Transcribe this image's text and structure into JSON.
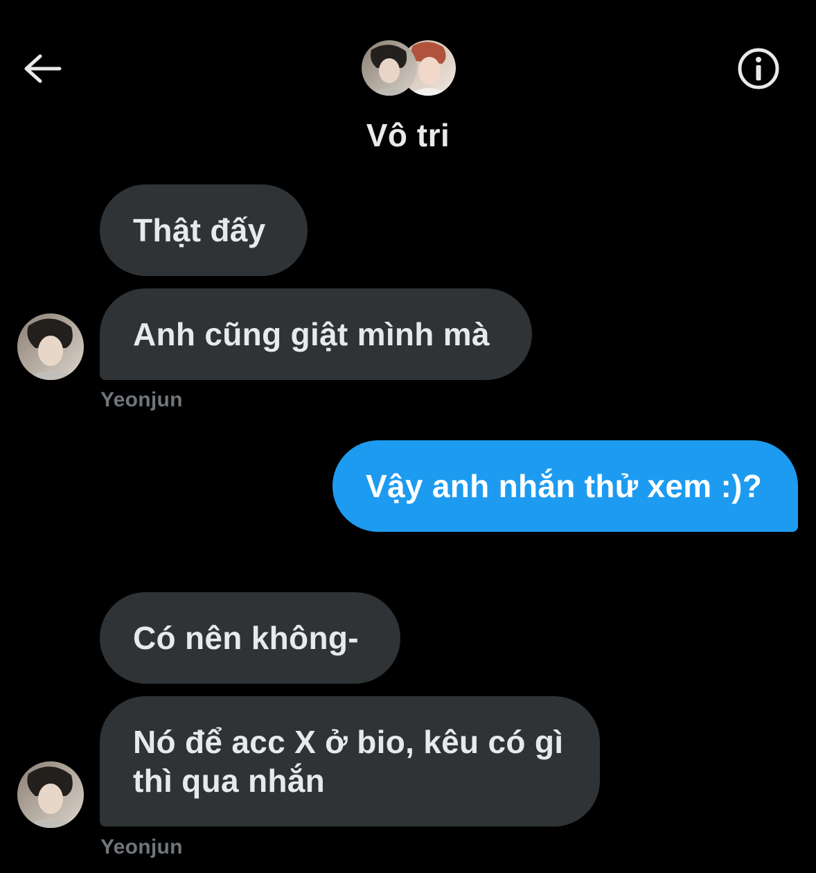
{
  "header": {
    "title": "Vô tri",
    "back_icon": "arrow-left-icon",
    "info_icon": "info-icon"
  },
  "colors": {
    "background": "#000000",
    "incoming_bubble": "#2f3336",
    "outgoing_bubble": "#1d9bf0",
    "text": "#e7e9ea",
    "muted": "#71767b"
  },
  "messages": [
    {
      "direction": "incoming",
      "text": "Thật đấy"
    },
    {
      "direction": "incoming",
      "text": "Anh cũng giật mình mà",
      "sender": "Yeonjun"
    },
    {
      "direction": "outgoing",
      "text": "Vậy anh nhắn thử xem :)?"
    },
    {
      "direction": "incoming",
      "text": "Có nên không-"
    },
    {
      "direction": "incoming",
      "text_line1": "Nó để acc X ở bio, kêu có gì",
      "text_line2": "thì qua nhắn",
      "sender": "Yeonjun"
    }
  ]
}
